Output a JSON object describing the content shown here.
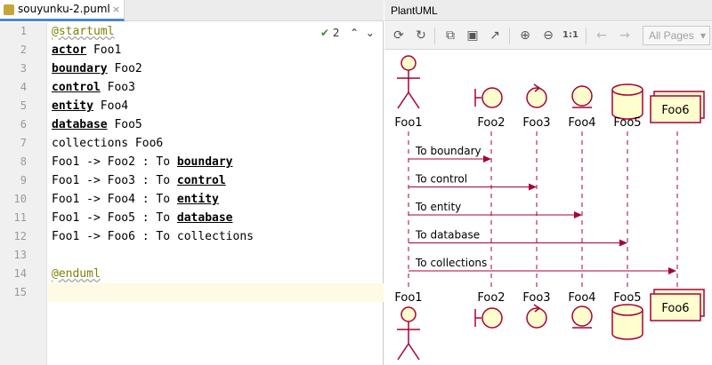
{
  "editor": {
    "tab_title": "souyunku-2.puml",
    "tab_close": "×",
    "inspection_count": "2",
    "lines": [
      {
        "n": "1",
        "parts": [
          {
            "t": "@startuml",
            "s": "directive"
          }
        ]
      },
      {
        "n": "2",
        "parts": [
          {
            "t": "actor",
            "s": "kw"
          },
          {
            "t": " Foo1",
            "s": ""
          }
        ]
      },
      {
        "n": "3",
        "parts": [
          {
            "t": "boundary",
            "s": "kw"
          },
          {
            "t": " Foo2",
            "s": ""
          }
        ]
      },
      {
        "n": "4",
        "parts": [
          {
            "t": "control",
            "s": "kw"
          },
          {
            "t": " Foo3",
            "s": ""
          }
        ]
      },
      {
        "n": "5",
        "parts": [
          {
            "t": "entity",
            "s": "kw"
          },
          {
            "t": " Foo4",
            "s": ""
          }
        ]
      },
      {
        "n": "6",
        "parts": [
          {
            "t": "database",
            "s": "kw"
          },
          {
            "t": " Foo5",
            "s": ""
          }
        ]
      },
      {
        "n": "7",
        "parts": [
          {
            "t": "collections Foo6",
            "s": ""
          }
        ]
      },
      {
        "n": "8",
        "parts": [
          {
            "t": "Foo1 -> Foo2 : To ",
            "s": ""
          },
          {
            "t": "boundary",
            "s": "kw"
          }
        ]
      },
      {
        "n": "9",
        "parts": [
          {
            "t": "Foo1 -> Foo3 : To ",
            "s": ""
          },
          {
            "t": "control",
            "s": "kw"
          }
        ]
      },
      {
        "n": "10",
        "parts": [
          {
            "t": "Foo1 -> Foo4 : To ",
            "s": ""
          },
          {
            "t": "entity",
            "s": "kw"
          }
        ]
      },
      {
        "n": "11",
        "parts": [
          {
            "t": "Foo1 -> Foo5 : To ",
            "s": ""
          },
          {
            "t": "database",
            "s": "kw"
          }
        ]
      },
      {
        "n": "12",
        "parts": [
          {
            "t": "Foo1 -> Foo6 : To collections",
            "s": ""
          }
        ]
      },
      {
        "n": "13",
        "parts": []
      },
      {
        "n": "14",
        "parts": [
          {
            "t": "@enduml",
            "s": "directive"
          }
        ]
      },
      {
        "n": "15",
        "parts": []
      }
    ],
    "current_line": "15"
  },
  "tool": {
    "title": "PlantUML",
    "toolbar": {
      "icons": [
        "refresh-icon",
        "reload-icon",
        "copy-icon",
        "save-icon",
        "open-external-icon",
        "zoom-in-icon",
        "zoom-out-icon",
        "actual-size-icon",
        "back-icon",
        "forward-icon"
      ],
      "actual_size_label": "1:1",
      "pages_select": "All Pages"
    }
  },
  "diagram": {
    "participants": [
      {
        "name": "Foo1",
        "kind": "actor"
      },
      {
        "name": "Foo2",
        "kind": "boundary"
      },
      {
        "name": "Foo3",
        "kind": "control"
      },
      {
        "name": "Foo4",
        "kind": "entity"
      },
      {
        "name": "Foo5",
        "kind": "database"
      },
      {
        "name": "Foo6",
        "kind": "collections"
      }
    ],
    "messages": [
      {
        "from": "Foo1",
        "to": "Foo2",
        "label": "To boundary"
      },
      {
        "from": "Foo1",
        "to": "Foo3",
        "label": "To control"
      },
      {
        "from": "Foo1",
        "to": "Foo4",
        "label": "To entity"
      },
      {
        "from": "Foo1",
        "to": "Foo5",
        "label": "To database"
      },
      {
        "from": "Foo1",
        "to": "Foo6",
        "label": "To collections"
      }
    ],
    "colors": {
      "stroke": "#a80036",
      "fill": "#fefece"
    }
  }
}
